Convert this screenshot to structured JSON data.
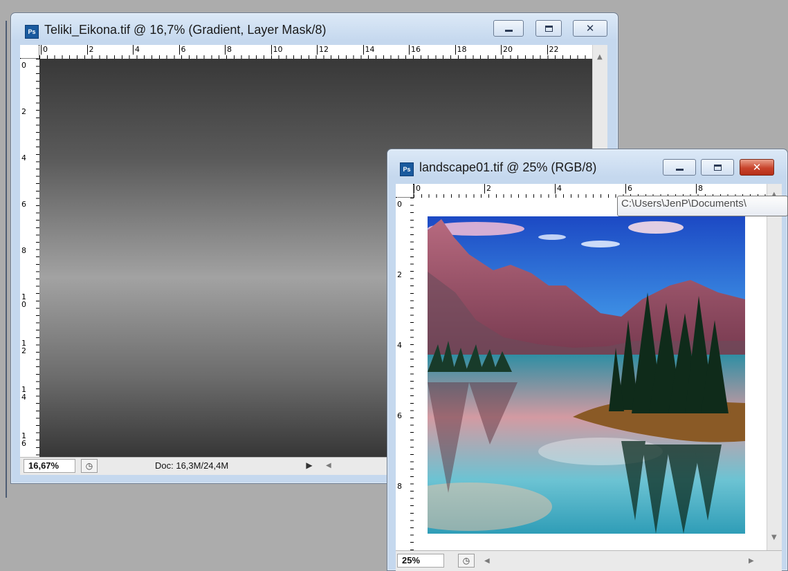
{
  "window1": {
    "title": "Teliki_Eikona.tif @ 16,7% (Gradient, Layer Mask/8)",
    "app_icon": "Ps",
    "ruler_h": [
      "0",
      "2",
      "4",
      "6",
      "8",
      "10",
      "12",
      "14",
      "16",
      "18",
      "20",
      "22"
    ],
    "ruler_v": [
      "0",
      "2",
      "4",
      "6",
      "8",
      "1\n0",
      "1\n2",
      "1\n4",
      "1\n6"
    ],
    "status": {
      "zoom": "16,67%",
      "doc_info": "Doc: 16,3M/24,4M",
      "arrow": "▶",
      "scroll_left": "◀"
    }
  },
  "window2": {
    "title": "landscape01.tif @ 25% (RGB/8)",
    "app_icon": "Ps",
    "ruler_h": [
      "0",
      "2",
      "4",
      "6",
      "8"
    ],
    "ruler_v": [
      "0",
      "2",
      "4",
      "6",
      "8"
    ],
    "status": {
      "zoom": "25%",
      "scroll_left": "◀",
      "scroll_right": "▶"
    },
    "scroll_up": "▲",
    "scroll_down": "▼"
  },
  "tooltip": "C:\\Users\\JenP\\Documents\\",
  "icons": {
    "minimize": "minimize-icon",
    "maximize": "maximize-icon",
    "close": "close-icon",
    "document-status": "timer-icon"
  },
  "colors": {
    "title_bar": "#c5d8ee",
    "close_red": "#c8442c",
    "ps_blue": "#1a5a9e",
    "workspace": "#acacac"
  }
}
